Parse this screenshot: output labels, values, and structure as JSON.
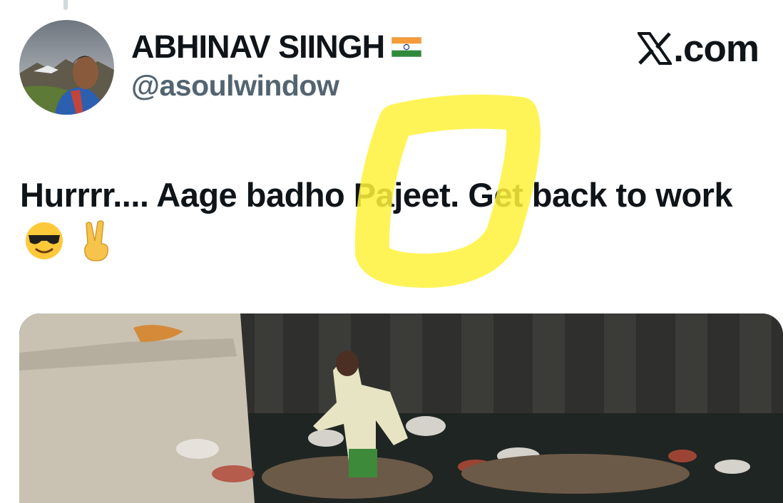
{
  "tweet": {
    "display_name": "ABHINAV SIINGH",
    "handle": "@asoulwindow",
    "text": "Hurrrr.... Aage badho Pajeet. Get back to work",
    "emojis": [
      "smiling-face-with-sunglasses",
      "victory-hand"
    ]
  },
  "watermark": {
    "label": ".com",
    "logo": "x-logo-icon"
  },
  "icons": [
    "india-flag-icon",
    "x-logo-icon"
  ],
  "colors": {
    "text": "#0f1419",
    "handle": "#536471",
    "highlight": "#fff23a"
  }
}
